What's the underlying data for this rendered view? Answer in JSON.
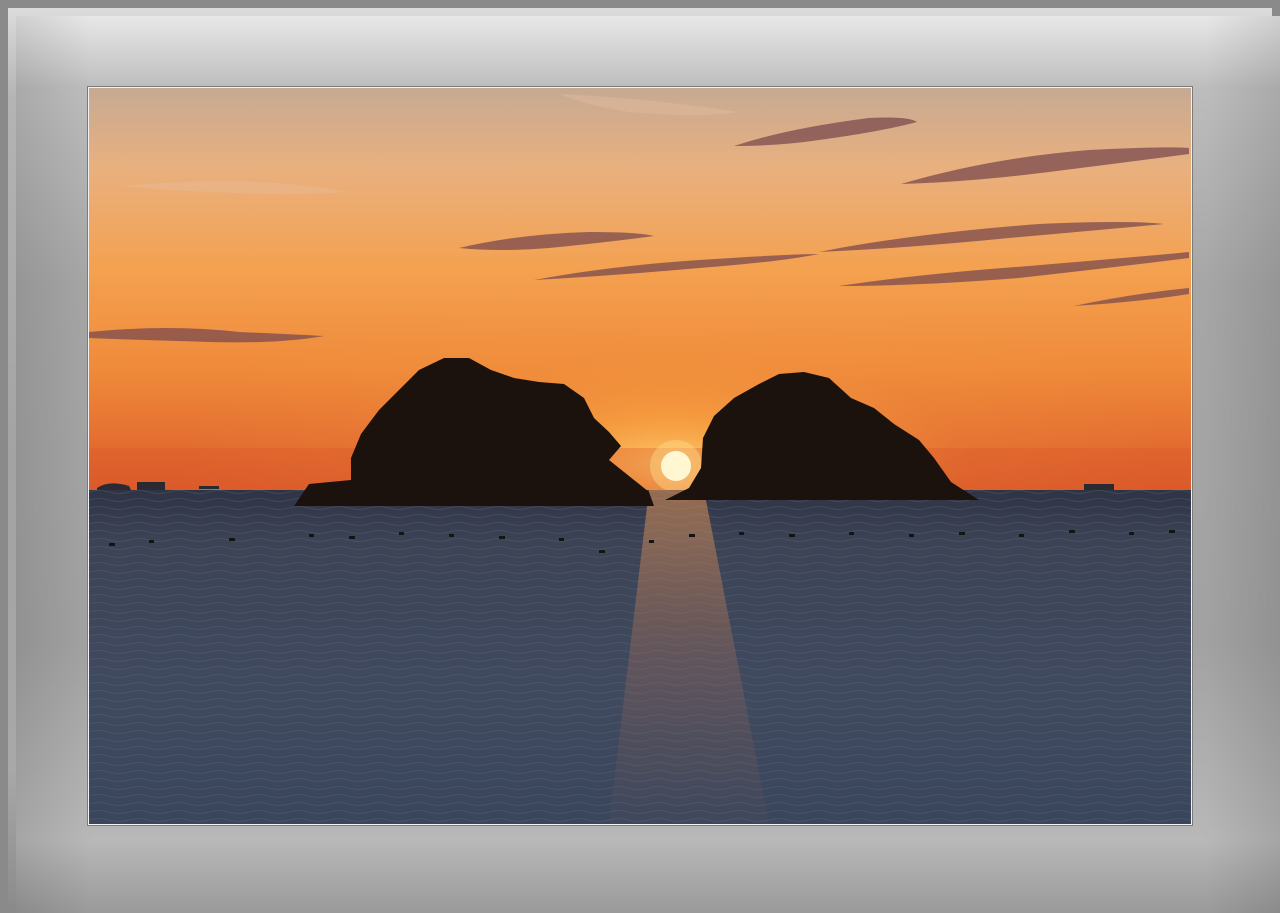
{
  "scene": {
    "subject": "sunset-over-sea-with-two-islands",
    "colors": {
      "sky_top": "#c9a88a",
      "sky_mid": "#f2a24d",
      "sky_horizon": "#e2612d",
      "sun": "#fff3c4",
      "sun_glow": "#ffb347",
      "sea_top": "#3d4456",
      "sea_bottom": "#3e4a60",
      "island": "#1a120e",
      "cloud": "#7a4a4a",
      "frame": "#a6a6a6",
      "mat_border": "#f2f2f2"
    }
  }
}
